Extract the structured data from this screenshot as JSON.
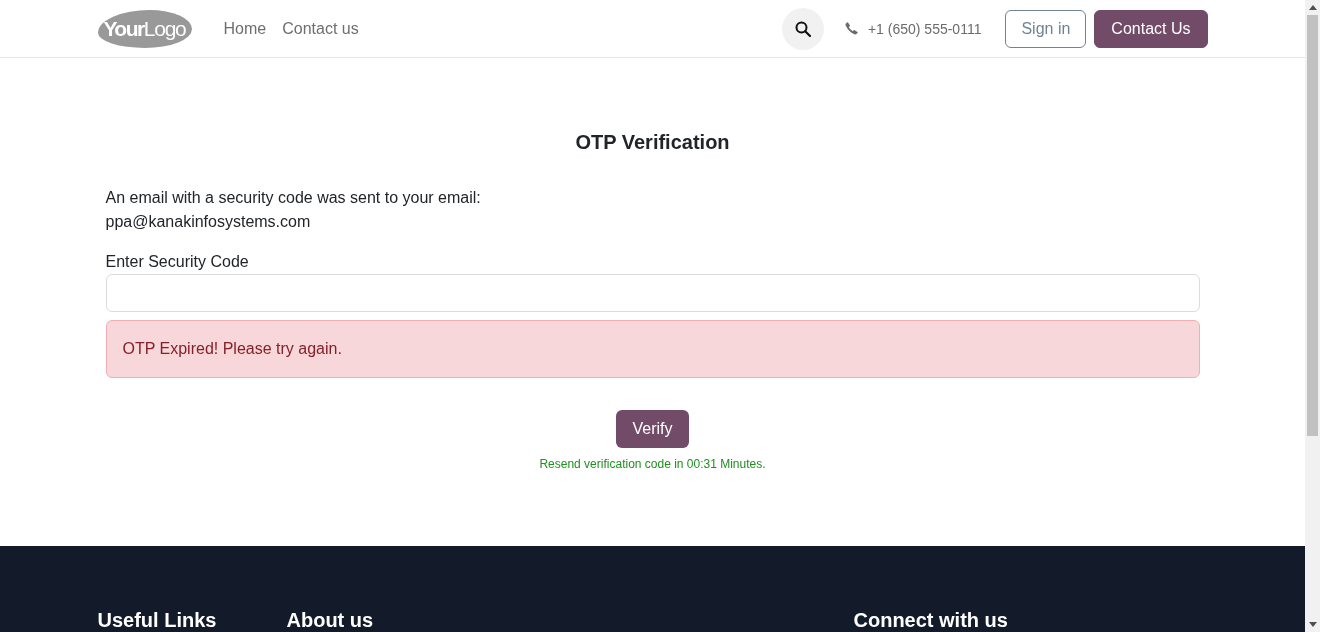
{
  "header": {
    "logo": "**Your**Logo",
    "nav": [
      {
        "label": "Home"
      },
      {
        "label": "Contact us"
      }
    ],
    "phone": "+1 (650) 555-0111",
    "buttons": [
      {
        "label": "Sign in",
        "kind": "outline"
      },
      {
        "label": "Contact Us",
        "kind": "primary"
      }
    ]
  },
  "main": {
    "title": "OTP Verification",
    "message": "An email with a security code was sent to your email:",
    "email": "ppa@kanakinfosystems.com",
    "field": {
      "label": "Enter Security Code"
    },
    "alert": "OTP Expired! Please try again.",
    "verify_button": "Verify",
    "resend_note": "Resend verification code in 00:31 Minutes."
  },
  "footer": {
    "headings": [
      "Useful Links",
      "About us",
      "Connect with us"
    ]
  }
}
